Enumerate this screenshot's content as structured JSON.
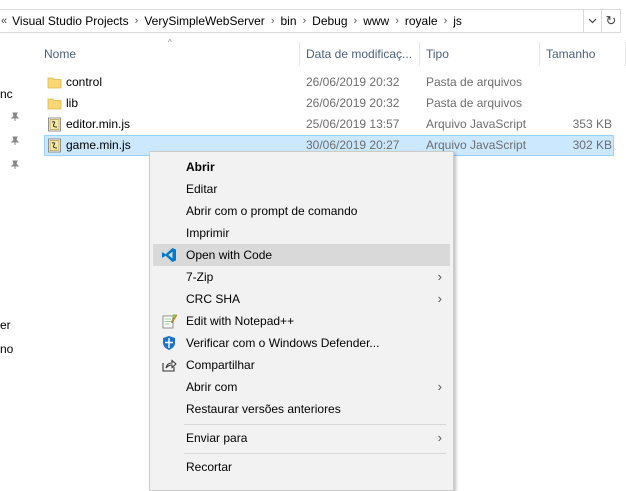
{
  "address": {
    "lead": "«",
    "crumbs": [
      "Visual Studio Projects",
      "VerySimpleWebServer",
      "bin",
      "Debug",
      "www",
      "royale",
      "js"
    ],
    "separator": "›",
    "dropdown": "v",
    "refresh": "↻"
  },
  "nav": {
    "fragments": [
      "nc",
      "er",
      "no"
    ]
  },
  "columns": {
    "name": "Nome",
    "date": "Data de modificaç...",
    "type": "Tipo",
    "size": "Tamanho",
    "sort_indicator": "^"
  },
  "files": [
    {
      "name": "control",
      "date": "26/06/2019 20:32",
      "type": "Pasta de arquivos",
      "size": "",
      "icon": "folder-icon"
    },
    {
      "name": "lib",
      "date": "26/06/2019 20:32",
      "type": "Pasta de arquivos",
      "size": "",
      "icon": "folder-icon"
    },
    {
      "name": "editor.min.js",
      "date": "25/06/2019 13:57",
      "type": "Arquivo JavaScript",
      "size": "353 KB",
      "icon": "js-file-icon"
    },
    {
      "name": "game.min.js",
      "date": "30/06/2019 20:27",
      "type": "Arquivo JavaScript",
      "size": "302 KB",
      "icon": "js-file-icon"
    }
  ],
  "menu": {
    "items": [
      {
        "label": "Abrir",
        "bold": true
      },
      {
        "label": "Editar"
      },
      {
        "label": "Abrir com o prompt de comando"
      },
      {
        "label": "Imprimir"
      },
      {
        "label": "Open with Code",
        "icon": "vscode-icon",
        "highlighted": true
      },
      {
        "label": "7-Zip",
        "submenu": true
      },
      {
        "label": "CRC SHA",
        "submenu": true
      },
      {
        "label": "Edit with Notepad++",
        "icon": "notepadpp-icon"
      },
      {
        "label": "Verificar com o Windows Defender...",
        "icon": "defender-icon"
      },
      {
        "label": "Compartilhar",
        "icon": "share-icon"
      },
      {
        "label": "Abrir com",
        "submenu": true
      },
      {
        "label": "Restaurar versões anteriores"
      },
      {
        "label": "Enviar para",
        "submenu": true
      },
      {
        "label": "Recortar"
      }
    ],
    "submenu_arrow": "›"
  },
  "colors": {
    "selection_bg": "#cce8ff",
    "selection_border": "#99d1ff",
    "menu_bg": "#f2f2f2",
    "menu_hover": "#d9d9d9",
    "header_text": "#4c607a",
    "folder": "#f8d775",
    "vscode": "#007acc"
  }
}
